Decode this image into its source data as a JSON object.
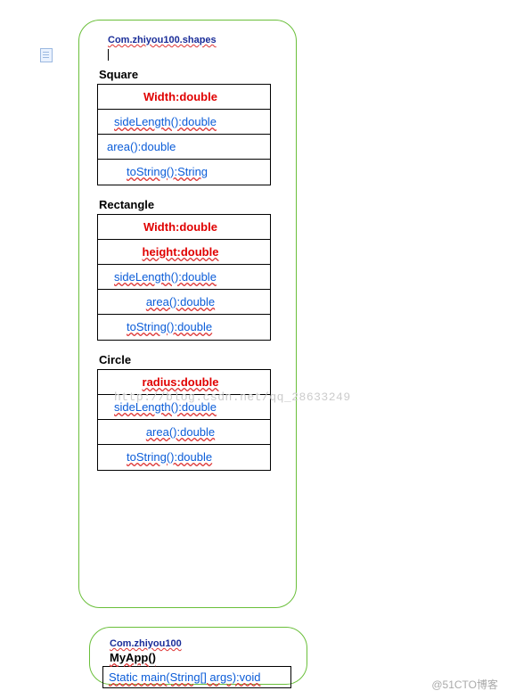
{
  "package_main": {
    "title": "Com.zhiyou100.shapes",
    "classes": [
      {
        "name": "Square",
        "rows": [
          {
            "text": "Width:double",
            "cls": "attr"
          },
          {
            "text": "sideLength():double",
            "cls": "pad1 und"
          },
          {
            "text": "area():double",
            "cls": ""
          },
          {
            "text": "toString():String",
            "cls": "pad2 und"
          }
        ]
      },
      {
        "name": "Rectangle",
        "rows": [
          {
            "text": "Width:double",
            "cls": "attr"
          },
          {
            "text": "height:double",
            "cls": "attr und"
          },
          {
            "text": "sideLength():double",
            "cls": "pad1 und"
          },
          {
            "text": "area():double",
            "cls": "center und"
          },
          {
            "text": "toString():double",
            "cls": "pad2 und"
          }
        ]
      },
      {
        "name": "Circle",
        "rows": [
          {
            "text": "radius:double",
            "cls": "attr und"
          },
          {
            "text": "sideLength():double",
            "cls": "pad1 und"
          },
          {
            "text": "area():double",
            "cls": "center und"
          },
          {
            "text": "toString():double",
            "cls": "pad2 und"
          }
        ]
      }
    ]
  },
  "package_app": {
    "title": "Com.zhiyou100",
    "class_name": "MyApp()",
    "method": "Static main(String[] args):void"
  },
  "watermark": "http://blog.csdn.net/qq_28633249",
  "footer": "@51CTO博客"
}
